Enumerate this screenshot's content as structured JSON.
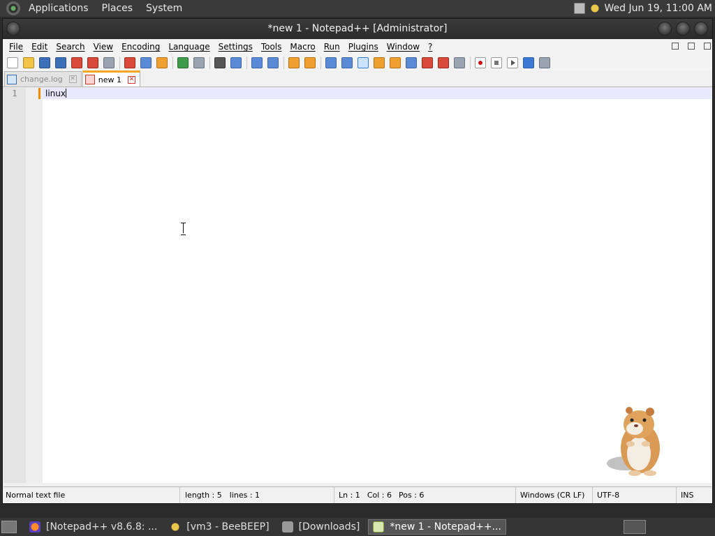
{
  "top_panel": {
    "menus": [
      "Applications",
      "Places",
      "System"
    ],
    "clock": "Wed Jun 19, 11:00 AM"
  },
  "window": {
    "title": "*new 1 - Notepad++ [Administrator]"
  },
  "menubar": [
    "File",
    "Edit",
    "Search",
    "View",
    "Encoding",
    "Language",
    "Settings",
    "Tools",
    "Macro",
    "Run",
    "Plugins",
    "Window",
    "?"
  ],
  "toolbar": {
    "icons": [
      "new-file-icon",
      "open-file-icon",
      "save-icon",
      "save-all-icon",
      "close-icon",
      "close-all-icon",
      "print-icon",
      "cut-icon",
      "copy-icon",
      "paste-icon",
      "undo-icon",
      "redo-icon",
      "find-icon",
      "replace-icon",
      "zoom-in-icon",
      "zoom-out-icon",
      "sync-vertical-icon",
      "sync-horizontal-icon",
      "word-wrap-icon",
      "show-all-chars-icon",
      "indent-guide-icon",
      "language-icon",
      "function-list-icon",
      "document-map-icon",
      "folder-workspace-icon",
      "clipboard-history-icon",
      "record-macro-icon",
      "stop-record-icon",
      "playback-macro-icon",
      "run-macro-multiple-icon",
      "save-macro-icon"
    ]
  },
  "tabs": [
    {
      "label": "change.log",
      "active": false
    },
    {
      "label": "new 1",
      "active": true
    }
  ],
  "editor": {
    "line_number": "1",
    "content": "linux"
  },
  "statusbar": {
    "filetype": "Normal text file",
    "length": "length : 5",
    "lines": "lines : 1",
    "ln": "Ln : 1",
    "col": "Col : 6",
    "pos": "Pos : 6",
    "eol": "Windows (CR LF)",
    "encoding": "UTF-8",
    "mode": "INS"
  },
  "taskbar": {
    "tasks": [
      {
        "label": "[Notepad++ v8.6.8: ...",
        "icon": "firefox-icon"
      },
      {
        "label": "[vm3 - BeeBEEP]",
        "icon": "beebeep-icon"
      },
      {
        "label": "[Downloads]",
        "icon": "folder-icon"
      },
      {
        "label": "*new 1 - Notepad++...",
        "icon": "notepad-icon"
      }
    ]
  }
}
